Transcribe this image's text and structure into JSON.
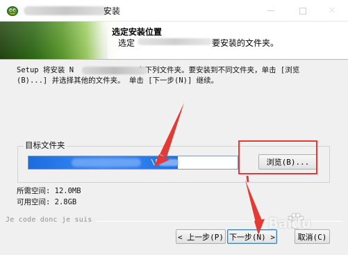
{
  "window": {
    "title_suffix": "安装",
    "icon": "installer-app-icon",
    "controls": [
      "minimize-icon",
      "maximize-icon",
      "close-icon"
    ],
    "close_glyph": "✕"
  },
  "header": {
    "title": "选定安装位置",
    "subtitle_prefix": "选定",
    "subtitle_suffix": "要安装的文件夹。"
  },
  "description": {
    "line1_a": "Setup 将安装 N",
    "line1_b": "在下列文件夹。要安装到不同文件夹，单击 [浏览",
    "line2": "(B)...] 并选择其他的文件夹。 单击 [下一步(N)] 继续。"
  },
  "destination": {
    "group_label": "目标文件夹",
    "path_visible_fragment": "\\N",
    "path_tail": "+",
    "browse_label": "浏览(B)..."
  },
  "space": {
    "required": "所需空间: 12.0MB",
    "available": "可用空间: 2.8GB"
  },
  "footer": {
    "brand": "Je code donc je suis",
    "back_label": "< 上一步(P)",
    "next_label": "下一步(N) >",
    "cancel_label": "取消(C)"
  },
  "watermark": {
    "text": "Baidu"
  },
  "annotation": {
    "color": "#e33a36"
  },
  "colors": {
    "header_green": "#2f6b17",
    "selection_blue": "#1b6ce0"
  }
}
